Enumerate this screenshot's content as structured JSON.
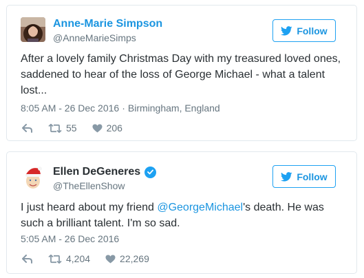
{
  "tweets": [
    {
      "display_name": "Anne-Marie Simpson",
      "handle": "@AnneMarieSimps",
      "name_color": "#1b95e0",
      "verified": false,
      "follow_label": "Follow",
      "text": "After a lovely family Christmas Day with my treasured loved ones, saddened to hear of the loss of George Michael - what a talent lost...",
      "timestamp": "8:05 AM - 26 Dec 2016",
      "location": "Birmingham, England",
      "retweets": "55",
      "likes": "206"
    },
    {
      "display_name": "Ellen DeGeneres",
      "handle": "@TheEllenShow",
      "name_color": "#292f33",
      "verified": true,
      "follow_label": "Follow",
      "text_before": "I just heard about my friend ",
      "mention": "@GeorgeMichael",
      "text_after": "'s death. He was such a brilliant talent. I'm so sad.",
      "timestamp": "5:05 AM - 26 Dec 2016",
      "retweets": "4,204",
      "likes": "22,269"
    }
  ],
  "colors": {
    "accent": "#1da1f2",
    "link": "#1b95e0",
    "muted": "#66757f",
    "border": "#e1e8ed"
  }
}
